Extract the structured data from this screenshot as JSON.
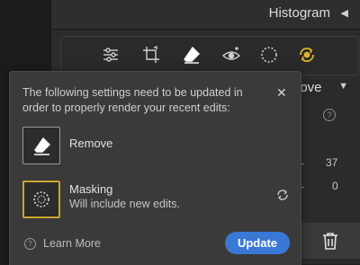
{
  "panel": {
    "histogram_title": "Histogram",
    "section_title_partial": "nove",
    "value_1": "37",
    "value_2": "0"
  },
  "toolbar": {
    "icons": [
      "edit-sliders-icon",
      "crop-icon",
      "remove-eraser-icon",
      "red-eye-icon",
      "masking-icon",
      "presets-sync-icon"
    ],
    "active_color": "#e0b52a"
  },
  "dialog": {
    "message": "The following settings need to be updated in order to properly render your recent edits:",
    "items": [
      {
        "title": "Remove",
        "subtitle": ""
      },
      {
        "title": "Masking",
        "subtitle": "Will include new edits."
      }
    ],
    "learn_more": "Learn More",
    "update_label": "Update"
  },
  "colors": {
    "primary_button": "#3a78d6",
    "masking_highlight": "#c9a531"
  }
}
